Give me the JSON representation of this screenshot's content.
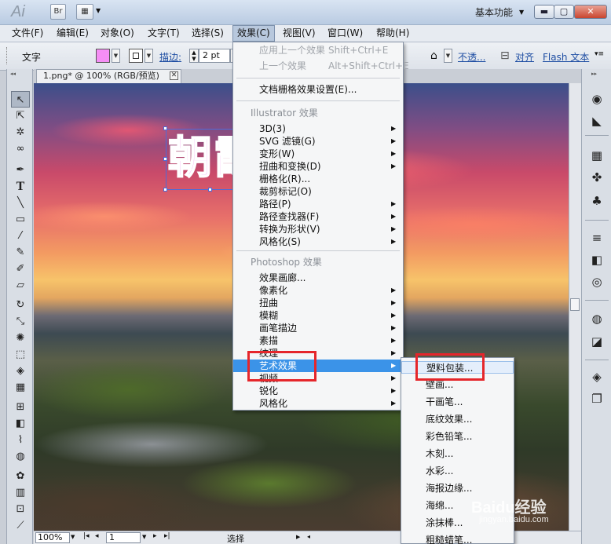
{
  "titlebar": {
    "workspace": "基本功能",
    "br_label": "Br",
    "window_min": "▬",
    "window_max": "▢",
    "window_close": "✕"
  },
  "menubar": [
    "文件(F)",
    "编辑(E)",
    "对象(O)",
    "文字(T)",
    "选择(S)",
    "效果(C)",
    "视图(V)",
    "窗口(W)",
    "帮助(H)"
  ],
  "controlbar": {
    "tool_label": "文字",
    "fill_color": "#f58ef5",
    "stroke_label": "描边:",
    "stroke_value": "2 pt",
    "opacity_label": "不透...",
    "align_label": "对齐",
    "flash_label": "Flash 文本"
  },
  "document": {
    "tab_title": "1.png* @ 100% (RGB/预览)",
    "art_text": "朝霞"
  },
  "statusbar": {
    "zoom": "100%",
    "page": "1",
    "tool": "选择"
  },
  "effect_menu": {
    "items": [
      {
        "label": "应用上一个效果",
        "shortcut": "Shift+Ctrl+E",
        "state": "disabled"
      },
      {
        "label": "上一个效果",
        "shortcut": "Alt+Shift+Ctrl+E",
        "state": "disabled"
      },
      {
        "label": "文档栅格效果设置(E)...",
        "shortcut": "",
        "state": "normal"
      },
      {
        "label": "Illustrator 效果",
        "state": "section"
      },
      {
        "label": "3D(3)",
        "submenu": true
      },
      {
        "label": "SVG 滤镜(G)",
        "submenu": true
      },
      {
        "label": "变形(W)",
        "submenu": true
      },
      {
        "label": "扭曲和变换(D)",
        "submenu": true
      },
      {
        "label": "栅格化(R)...",
        "submenu": false
      },
      {
        "label": "裁剪标记(O)",
        "submenu": false
      },
      {
        "label": "路径(P)",
        "submenu": true
      },
      {
        "label": "路径查找器(F)",
        "submenu": true
      },
      {
        "label": "转换为形状(V)",
        "submenu": true
      },
      {
        "label": "风格化(S)",
        "submenu": true
      },
      {
        "label": "Photoshop 效果",
        "state": "section"
      },
      {
        "label": "效果画廊...",
        "submenu": false
      },
      {
        "label": "像素化",
        "submenu": true
      },
      {
        "label": "扭曲",
        "submenu": true
      },
      {
        "label": "模糊",
        "submenu": true
      },
      {
        "label": "画笔描边",
        "submenu": true
      },
      {
        "label": "素描",
        "submenu": true
      },
      {
        "label": "纹理",
        "submenu": true
      },
      {
        "label": "艺术效果",
        "submenu": true,
        "state": "highlighted"
      },
      {
        "label": "视频",
        "submenu": true
      },
      {
        "label": "锐化",
        "submenu": true
      },
      {
        "label": "风格化",
        "submenu": true
      }
    ]
  },
  "artistic_submenu": {
    "items": [
      "塑料包装...",
      "壁画...",
      "干画笔...",
      "底纹效果...",
      "彩色铅笔...",
      "木刻...",
      "水彩...",
      "海报边缘...",
      "海绵...",
      "涂抹棒...",
      "粗糙蜡笔..."
    ]
  },
  "watermark": {
    "text": "Baidu经验",
    "url": "jingyan.baidu.com"
  },
  "colors": {
    "highlight": "#3b93e8",
    "annotation_red": "#e5262b",
    "selection_blue": "#4e6bd8"
  }
}
